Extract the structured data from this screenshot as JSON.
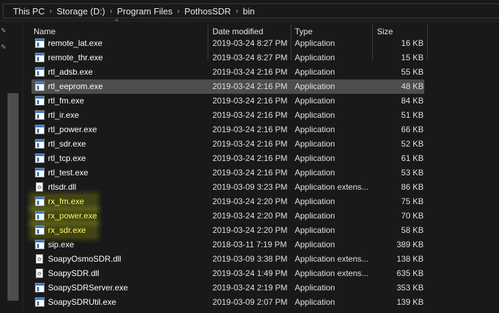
{
  "breadcrumb": {
    "items": [
      "This PC",
      "Storage (D:)",
      "Program Files",
      "PothosSDR",
      "bin"
    ],
    "separator": "›"
  },
  "columns": {
    "name": "Name",
    "date": "Date modified",
    "type": "Type",
    "size": "Size"
  },
  "colors": {
    "highlight": "#ffff5a",
    "selected_row": "#4d4d4d"
  },
  "files": [
    {
      "name": "remote_lat.exe",
      "date": "2019-03-24 8:27 PM",
      "type": "Application",
      "size": "16 KB",
      "icon": "exe-icon"
    },
    {
      "name": "remote_thr.exe",
      "date": "2019-03-24 8:27 PM",
      "type": "Application",
      "size": "15 KB",
      "icon": "exe-icon"
    },
    {
      "name": "rtl_adsb.exe",
      "date": "2019-03-24 2:16 PM",
      "type": "Application",
      "size": "55 KB",
      "icon": "exe-icon"
    },
    {
      "name": "rtl_eeprom.exe",
      "date": "2019-03-24 2:16 PM",
      "type": "Application",
      "size": "48 KB",
      "icon": "exe-icon",
      "selected": true
    },
    {
      "name": "rtl_fm.exe",
      "date": "2019-03-24 2:16 PM",
      "type": "Application",
      "size": "84 KB",
      "icon": "exe-icon"
    },
    {
      "name": "rtl_ir.exe",
      "date": "2019-03-24 2:16 PM",
      "type": "Application",
      "size": "51 KB",
      "icon": "exe-icon"
    },
    {
      "name": "rtl_power.exe",
      "date": "2019-03-24 2:16 PM",
      "type": "Application",
      "size": "66 KB",
      "icon": "exe-icon"
    },
    {
      "name": "rtl_sdr.exe",
      "date": "2019-03-24 2:16 PM",
      "type": "Application",
      "size": "52 KB",
      "icon": "exe-icon"
    },
    {
      "name": "rtl_tcp.exe",
      "date": "2019-03-24 2:16 PM",
      "type": "Application",
      "size": "61 KB",
      "icon": "exe-icon"
    },
    {
      "name": "rtl_test.exe",
      "date": "2019-03-24 2:16 PM",
      "type": "Application",
      "size": "53 KB",
      "icon": "exe-icon"
    },
    {
      "name": "rtlsdr.dll",
      "date": "2019-03-09 3:23 PM",
      "type": "Application extens...",
      "size": "86 KB",
      "icon": "dll-icon"
    },
    {
      "name": "rx_fm.exe",
      "date": "2019-03-24 2:20 PM",
      "type": "Application",
      "size": "75 KB",
      "icon": "exe-icon",
      "highlighted": true
    },
    {
      "name": "rx_power.exe",
      "date": "2019-03-24 2:20 PM",
      "type": "Application",
      "size": "70 KB",
      "icon": "exe-icon",
      "highlighted": true
    },
    {
      "name": "rx_sdr.exe",
      "date": "2019-03-24 2:20 PM",
      "type": "Application",
      "size": "58 KB",
      "icon": "exe-icon",
      "highlighted": true
    },
    {
      "name": "sip.exe",
      "date": "2018-03-11 7:19 PM",
      "type": "Application",
      "size": "389 KB",
      "icon": "exe-icon"
    },
    {
      "name": "SoapyOsmoSDR.dll",
      "date": "2019-03-09 3:38 PM",
      "type": "Application extens...",
      "size": "138 KB",
      "icon": "dll-icon"
    },
    {
      "name": "SoapySDR.dll",
      "date": "2019-03-24 1:49 PM",
      "type": "Application extens...",
      "size": "635 KB",
      "icon": "dll-icon"
    },
    {
      "name": "SoapySDRServer.exe",
      "date": "2019-03-24 2:19 PM",
      "type": "Application",
      "size": "353 KB",
      "icon": "exe-icon"
    },
    {
      "name": "SoapySDRUtil.exe",
      "date": "2019-03-09 2:07 PM",
      "type": "Application",
      "size": "139 KB",
      "icon": "exe-icon"
    }
  ]
}
